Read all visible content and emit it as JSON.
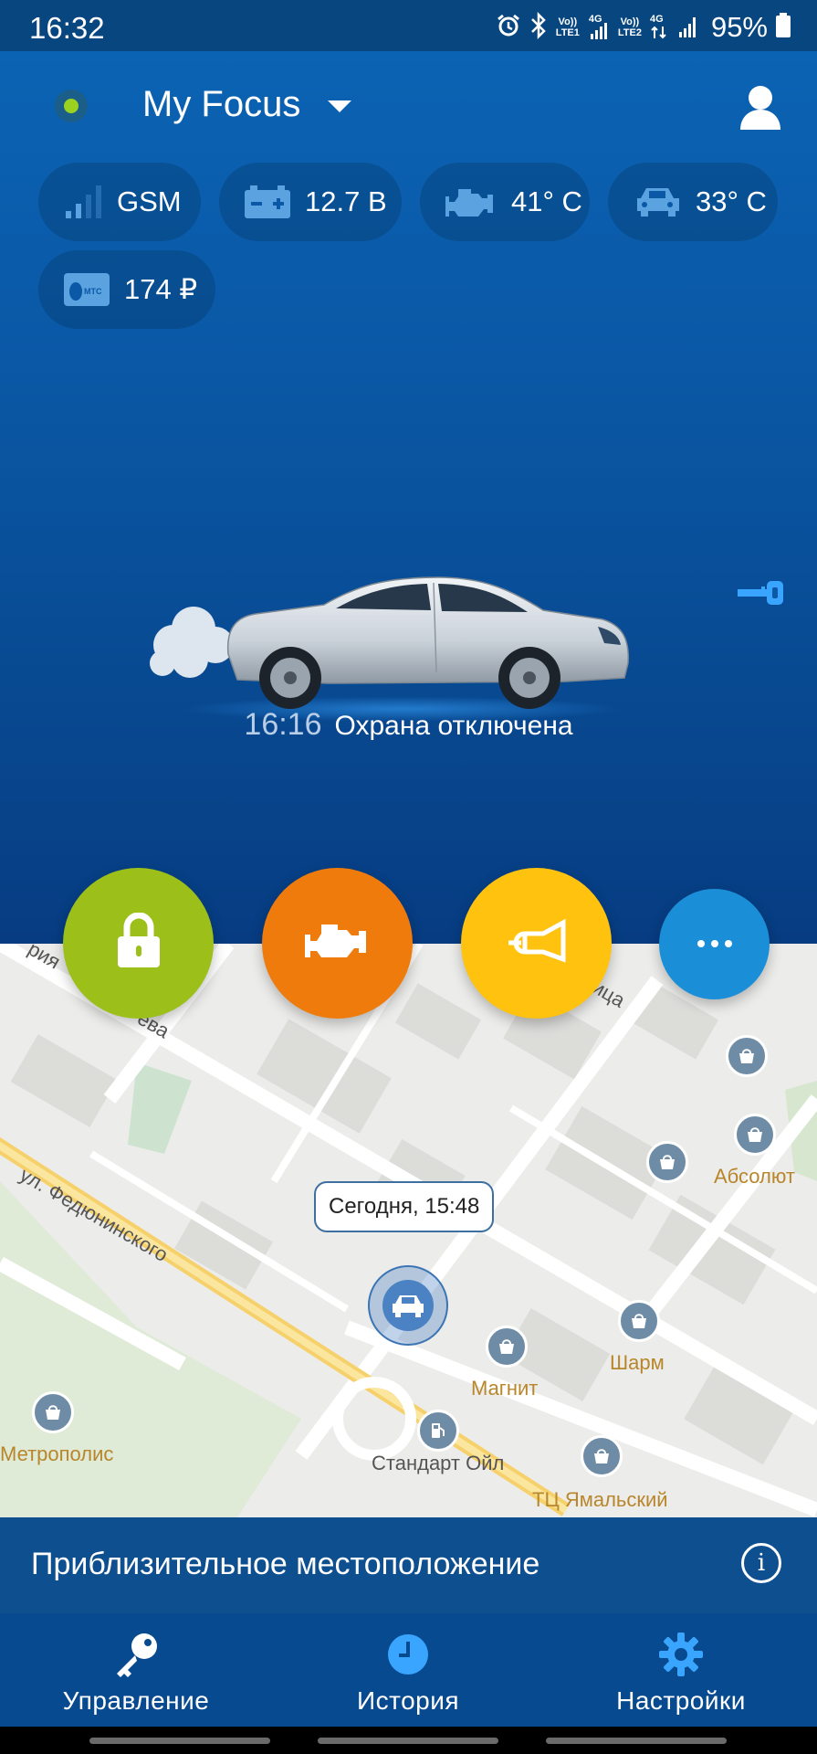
{
  "status_bar": {
    "time": "16:32",
    "battery_percent": "95%",
    "sim1_lines": [
      "Vo))",
      "LTE1"
    ],
    "sim2_lines": [
      "Vo))",
      "LTE2"
    ],
    "net_4g": "4G",
    "icons": [
      "alarm-icon",
      "bluetooth-icon",
      "signal-icon",
      "battery-icon"
    ]
  },
  "header": {
    "car_name": "My Focus",
    "online_dot_color": "#9ad21f"
  },
  "indicators": {
    "gsm": "GSM",
    "battery": "12.7 В",
    "engine_temp": "41° C",
    "cabin_temp": "33° C",
    "balance": "174 ₽",
    "operator_logo": "МТС"
  },
  "car_status": {
    "time": "16:16",
    "text": "Охрана отключена"
  },
  "actions": {
    "lock_color": "#9cbf1a",
    "engine_color": "#ef7b0c",
    "horn_color": "#ffc20e",
    "more_color": "#1a8fd8"
  },
  "map": {
    "streets": [
      "ул. Федюнинского",
      "ица",
      "ева",
      "рия"
    ],
    "pois": [
      "Абсолют",
      "Шарм",
      "Магнит",
      "Метрополис",
      "Стандарт Ойл",
      "ТЦ Ямальский"
    ],
    "callout": "Сегодня, 15:48"
  },
  "info_bar": {
    "text": "Приблизительное местоположение",
    "info_glyph": "i"
  },
  "bottom_nav": {
    "items": [
      {
        "label": "Управление",
        "icon": "key-icon"
      },
      {
        "label": "История",
        "icon": "clock-icon"
      },
      {
        "label": "Настройки",
        "icon": "gear-icon"
      }
    ]
  }
}
